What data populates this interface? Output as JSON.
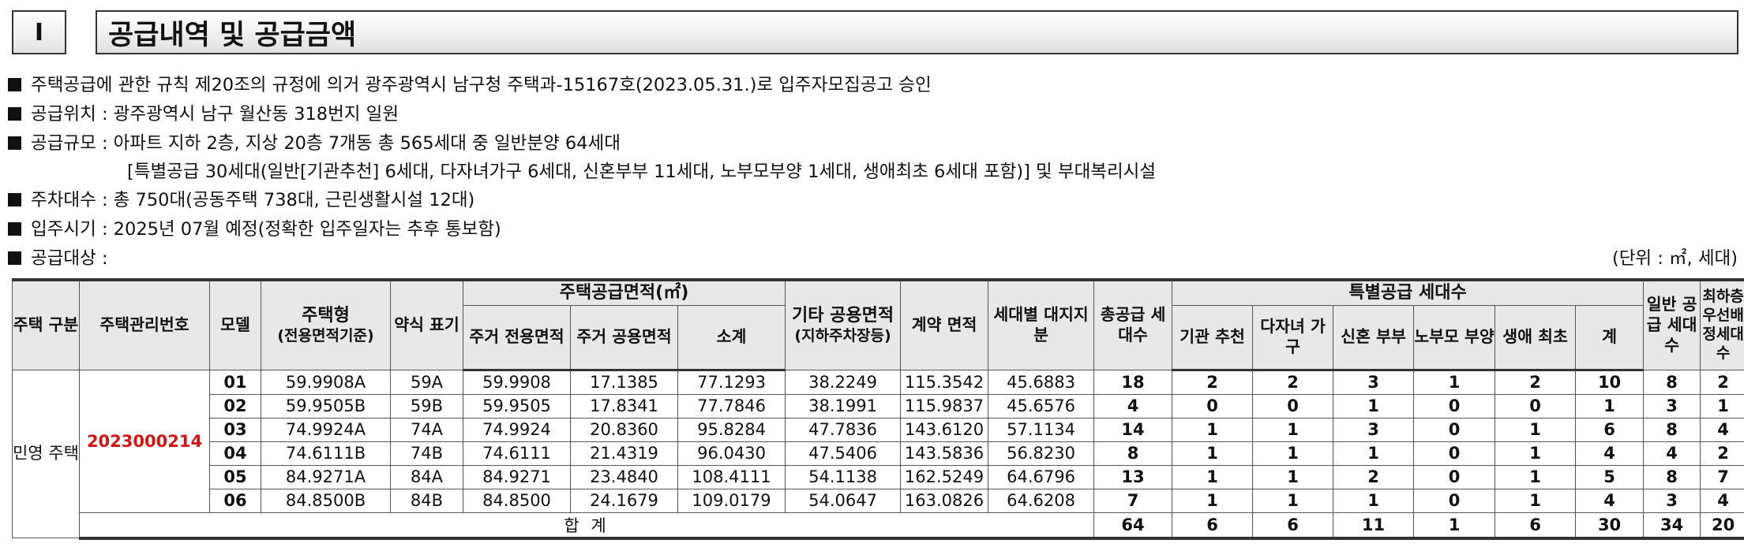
{
  "section": {
    "number": "I",
    "title": "공급내역 및 공급금액"
  },
  "notes": [
    "주택공급에 관한 규칙 제20조의 규정에 의거 광주광역시 남구청 주택과-15167호(2023.05.31.)로 입주자모집공고 승인",
    "공급위치 : 광주광역시 남구 월산동 318번지 일원",
    "공급규모 : 아파트 지하 2층, 지상 20층 7개동 총 565세대 중 일반분양 64세대",
    "[특별공급 30세대(일반[기관추천] 6세대, 다자녀가구 6세대, 신혼부부 11세대, 노부모부양 1세대, 생애최초 6세대 포함)] 및 부대복리시설",
    "주차대수 : 총 750대(공동주택 738대, 근린생활시설 12대)",
    "입주시기 : 2025년 07월 예정(정확한 입주일자는 추후 통보함)",
    "공급대상 :"
  ],
  "unit_note": "(단위 : ㎡, 세대)",
  "headers": {
    "house_type_kind": "주택 구분",
    "mgmt_no": "주택관리번호",
    "model": "모델",
    "house_type": "주택형",
    "house_type_sub": "(전용면적기준)",
    "abbr": "약식 표기",
    "supply_area": "주택공급면적(㎡)",
    "exclusive": "주거 전용면적",
    "common": "주거 공용면적",
    "subtotal": "소계",
    "other_common": "기타 공용면적",
    "other_common_sub": "(지하주차장등)",
    "contract_area": "계약 면적",
    "land_share": "세대별 대지지분",
    "total_supply": "총공급 세대수",
    "special": "특별공급 세대수",
    "institution": "기관 추천",
    "multichild": "다자녀 가구",
    "newlywed": "신혼 부부",
    "elderly": "노부모 부양",
    "firsttime": "생애 최초",
    "special_sum": "계",
    "general": "일반 공급 세대수",
    "lowest_floor": "최하층 우선배 정세대 수"
  },
  "kind_label": "민영 주택",
  "mgmt_number": "2023000214",
  "rows": [
    {
      "model": "01",
      "type": "59.9908A",
      "abbr": "59A",
      "excl": "59.9908",
      "common": "17.1385",
      "sub": "77.1293",
      "other": "38.2249",
      "contract": "115.3542",
      "land": "45.6883",
      "total": "18",
      "inst": "2",
      "multi": "2",
      "newly": "3",
      "elder": "1",
      "first": "2",
      "ssum": "10",
      "gen": "8",
      "low": "2"
    },
    {
      "model": "02",
      "type": "59.9505B",
      "abbr": "59B",
      "excl": "59.9505",
      "common": "17.8341",
      "sub": "77.7846",
      "other": "38.1991",
      "contract": "115.9837",
      "land": "45.6576",
      "total": "4",
      "inst": "0",
      "multi": "0",
      "newly": "1",
      "elder": "0",
      "first": "0",
      "ssum": "1",
      "gen": "3",
      "low": "1"
    },
    {
      "model": "03",
      "type": "74.9924A",
      "abbr": "74A",
      "excl": "74.9924",
      "common": "20.8360",
      "sub": "95.8284",
      "other": "47.7836",
      "contract": "143.6120",
      "land": "57.1134",
      "total": "14",
      "inst": "1",
      "multi": "1",
      "newly": "3",
      "elder": "0",
      "first": "1",
      "ssum": "6",
      "gen": "8",
      "low": "4"
    },
    {
      "model": "04",
      "type": "74.6111B",
      "abbr": "74B",
      "excl": "74.6111",
      "common": "21.4319",
      "sub": "96.0430",
      "other": "47.5406",
      "contract": "143.5836",
      "land": "56.8230",
      "total": "8",
      "inst": "1",
      "multi": "1",
      "newly": "1",
      "elder": "0",
      "first": "1",
      "ssum": "4",
      "gen": "4",
      "low": "2"
    },
    {
      "model": "05",
      "type": "84.9271A",
      "abbr": "84A",
      "excl": "84.9271",
      "common": "23.4840",
      "sub": "108.4111",
      "other": "54.1138",
      "contract": "162.5249",
      "land": "64.6796",
      "total": "13",
      "inst": "1",
      "multi": "1",
      "newly": "2",
      "elder": "0",
      "first": "1",
      "ssum": "5",
      "gen": "8",
      "low": "7"
    },
    {
      "model": "06",
      "type": "84.8500B",
      "abbr": "84B",
      "excl": "84.8500",
      "common": "24.1679",
      "sub": "109.0179",
      "other": "54.0647",
      "contract": "163.0826",
      "land": "64.6208",
      "total": "7",
      "inst": "1",
      "multi": "1",
      "newly": "1",
      "elder": "0",
      "first": "1",
      "ssum": "4",
      "gen": "3",
      "low": "4"
    }
  ],
  "totals": {
    "label": "합 계",
    "total": "64",
    "inst": "6",
    "multi": "6",
    "newly": "11",
    "elder": "1",
    "first": "6",
    "ssum": "30",
    "gen": "34",
    "low": "20"
  }
}
